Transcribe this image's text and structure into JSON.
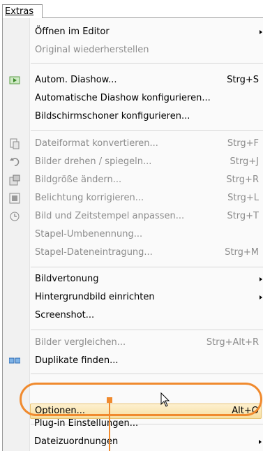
{
  "menubar": {
    "title": "Extras"
  },
  "menu": {
    "items": [
      {
        "label": "Öffnen im Editor",
        "shortcut": "",
        "submenu": true,
        "disabled": false,
        "icon": ""
      },
      {
        "label": "Original wiederherstellen",
        "shortcut": "",
        "submenu": false,
        "disabled": true,
        "icon": ""
      },
      {
        "label": "Autom. Diashow...",
        "shortcut": "Strg+S",
        "submenu": false,
        "disabled": false,
        "icon": "slideshow-icon"
      },
      {
        "label": "Automatische Diashow konfigurieren...",
        "shortcut": "",
        "submenu": false,
        "disabled": false,
        "icon": ""
      },
      {
        "label": "Bildschirmschoner konfigurieren...",
        "shortcut": "",
        "submenu": false,
        "disabled": false,
        "icon": ""
      },
      {
        "label": "Dateiformat konvertieren...",
        "shortcut": "Strg+F",
        "submenu": false,
        "disabled": true,
        "icon": "convert-format-icon"
      },
      {
        "label": "Bilder drehen / spiegeln...",
        "shortcut": "Strg+J",
        "submenu": false,
        "disabled": true,
        "icon": "rotate-icon"
      },
      {
        "label": "Bildgröße ändern...",
        "shortcut": "Strg+R",
        "submenu": false,
        "disabled": true,
        "icon": "resize-icon"
      },
      {
        "label": "Belichtung korrigieren...",
        "shortcut": "Strg+L",
        "submenu": false,
        "disabled": true,
        "icon": "exposure-icon"
      },
      {
        "label": "Bild und Zeitstempel anpassen...",
        "shortcut": "Strg+T",
        "submenu": false,
        "disabled": true,
        "icon": "timestamp-icon"
      },
      {
        "label": "Stapel-Umbenennung...",
        "shortcut": "",
        "submenu": false,
        "disabled": true,
        "icon": ""
      },
      {
        "label": "Stapel-Dateneintragung...",
        "shortcut": "Strg+M",
        "submenu": false,
        "disabled": true,
        "icon": ""
      },
      {
        "label": "Bildvertonung",
        "shortcut": "",
        "submenu": true,
        "disabled": false,
        "icon": ""
      },
      {
        "label": "Hintergrundbild einrichten",
        "shortcut": "",
        "submenu": true,
        "disabled": false,
        "icon": ""
      },
      {
        "label": "Screenshot...",
        "shortcut": "",
        "submenu": false,
        "disabled": false,
        "icon": ""
      },
      {
        "label": "Bilder vergleichen...",
        "shortcut": "Strg+Alt+R",
        "submenu": false,
        "disabled": true,
        "icon": ""
      },
      {
        "label": "Duplikate finden...",
        "shortcut": "",
        "submenu": false,
        "disabled": false,
        "icon": "duplicates-icon"
      },
      {
        "label": "Optionen...",
        "shortcut": "Alt+O",
        "submenu": false,
        "disabled": false,
        "icon": "",
        "highlighted": true
      },
      {
        "label": "Plug-in Einstellungen...",
        "shortcut": "",
        "submenu": false,
        "disabled": false,
        "icon": ""
      },
      {
        "label": "Dateizuordnungen",
        "shortcut": "",
        "submenu": true,
        "disabled": false,
        "icon": ""
      }
    ]
  },
  "colors": {
    "highlight_ring": "#f08a2e",
    "hover_fill": "#f8df9f",
    "disabled_text": "#8c8c8c"
  }
}
